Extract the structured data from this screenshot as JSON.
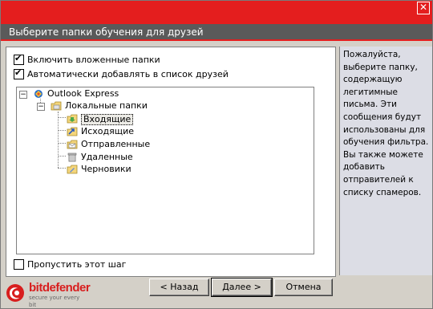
{
  "window": {
    "title": "Выберите папки обучения для друзей",
    "close_glyph": "✕"
  },
  "options": {
    "include_subfolders": {
      "label": "Включить вложенные папки",
      "checked": true
    },
    "auto_add_friends": {
      "label": "Автоматически добавлять в список друзей",
      "checked": true
    },
    "skip_step": {
      "label": "Пропустить этот шаг",
      "checked": false
    }
  },
  "tree": {
    "root": {
      "label": "Outlook Express",
      "icon": "outlook-express-icon"
    },
    "local": {
      "label": "Локальные папки",
      "icon": "local-folders-icon"
    },
    "folders": [
      {
        "label": "Входящие",
        "icon": "inbox-icon",
        "selected": true
      },
      {
        "label": "Исходящие",
        "icon": "outbox-icon",
        "selected": false
      },
      {
        "label": "Отправленные",
        "icon": "sent-icon",
        "selected": false
      },
      {
        "label": "Удаленные",
        "icon": "deleted-icon",
        "selected": false
      },
      {
        "label": "Черновики",
        "icon": "drafts-icon",
        "selected": false
      }
    ]
  },
  "info": {
    "text": "Пожалуйста, выберите папку, содержащую легитимные письма. Эти сообщения будут использованы для обучения фильтра. Вы также можете добавить отправителей к списку спамеров."
  },
  "brand": {
    "name": "bitdefender",
    "tagline": "secure your every bit",
    "color": "#d81e1e"
  },
  "buttons": {
    "back": "< Назад",
    "next": "Далее >",
    "cancel": "Отмена"
  },
  "colors": {
    "top_bar": "#e41e1e",
    "title_bar": "#5a5a5a",
    "dialog_bg": "#d4d0c8",
    "info_bg": "#dcdde5"
  }
}
